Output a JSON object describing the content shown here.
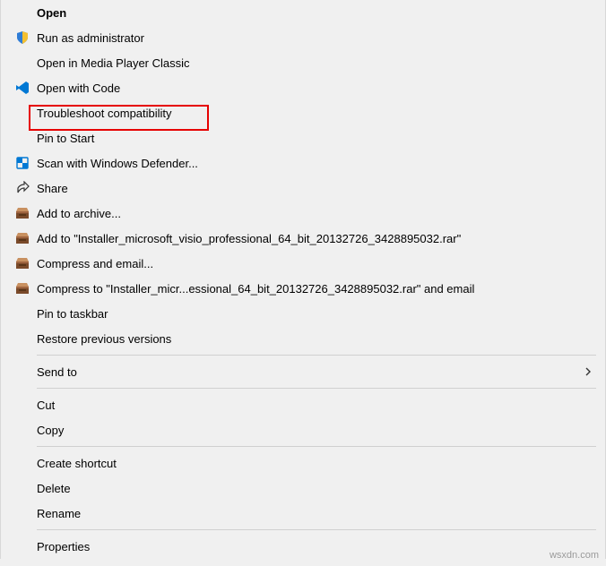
{
  "menu": {
    "open": "Open",
    "run_as_admin": "Run as administrator",
    "open_mpc": "Open in Media Player Classic",
    "open_with_code": "Open with Code",
    "troubleshoot": "Troubleshoot compatibility",
    "pin_to_start": "Pin to Start",
    "scan_defender": "Scan with Windows Defender...",
    "share": "Share",
    "add_to_archive": "Add to archive...",
    "add_to_named": "Add to \"Installer_microsoft_visio_professional_64_bit_20132726_3428895032.rar\"",
    "compress_email": "Compress and email...",
    "compress_to_named": "Compress to \"Installer_micr...essional_64_bit_20132726_3428895032.rar\" and email",
    "pin_to_taskbar": "Pin to taskbar",
    "restore_prev": "Restore previous versions",
    "send_to": "Send to",
    "cut": "Cut",
    "copy": "Copy",
    "create_shortcut": "Create shortcut",
    "delete": "Delete",
    "rename": "Rename",
    "properties": "Properties"
  },
  "watermark": "wsxdn.com"
}
